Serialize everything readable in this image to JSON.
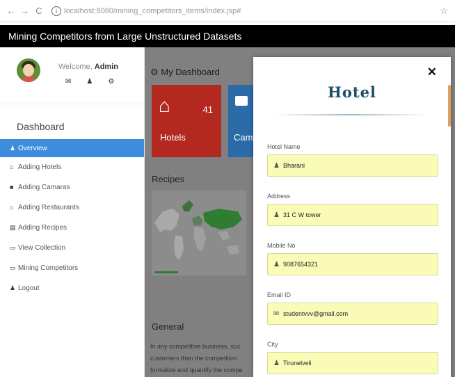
{
  "browser": {
    "url_host": "localhost",
    "url_path": ":8080/mining_competitors_items/index.jsp#"
  },
  "app": {
    "title": "Mining Competitors from Large Unstructured Datasets"
  },
  "profile": {
    "welcome_text": "Welcome, ",
    "user": "Admin"
  },
  "sidebar": {
    "heading": "Dashboard",
    "items": [
      {
        "label": "Overview",
        "icon": "user-icon"
      },
      {
        "label": "Adding Hotels",
        "icon": "home-icon"
      },
      {
        "label": "Adding Camaras",
        "icon": "camera-icon"
      },
      {
        "label": "Adding Restaurants",
        "icon": "home-icon"
      },
      {
        "label": "Adding Recipes",
        "icon": "book-icon"
      },
      {
        "label": "View Collection",
        "icon": "laptop-icon"
      },
      {
        "label": "Mining Competitors",
        "icon": "laptop-icon"
      },
      {
        "label": "Logout",
        "icon": "user-icon"
      }
    ]
  },
  "dashboard": {
    "heading": "My Dashboard",
    "tiles": [
      {
        "label": "Hotels",
        "count": "41",
        "color": "#b3281f"
      },
      {
        "label": "Cam",
        "color": "#2a6ba8"
      }
    ],
    "recipes_heading": "Recipes",
    "general_heading": "General",
    "general_lines": [
      "In any competitive business, suc",
      "customers than the competition",
      "formalize and quantify the compe"
    ]
  },
  "modal": {
    "title": "Hotel",
    "fields": [
      {
        "label": "Hotel Name",
        "value": "Bharani",
        "icon": "user-icon"
      },
      {
        "label": "Address",
        "value": "31 C W tower",
        "icon": "user-icon"
      },
      {
        "label": "Mobile No",
        "value": "9087654321",
        "icon": "user-icon"
      },
      {
        "label": "Email ID",
        "value": "studentvvv@gmail.com",
        "icon": "envelope-icon"
      },
      {
        "label": "City",
        "value": "Tirunelveli",
        "icon": "user-icon"
      }
    ]
  },
  "colors": {
    "accent": "#3c8dde",
    "input_bg": "#fbfbb8",
    "title": "#1f4e6b"
  }
}
